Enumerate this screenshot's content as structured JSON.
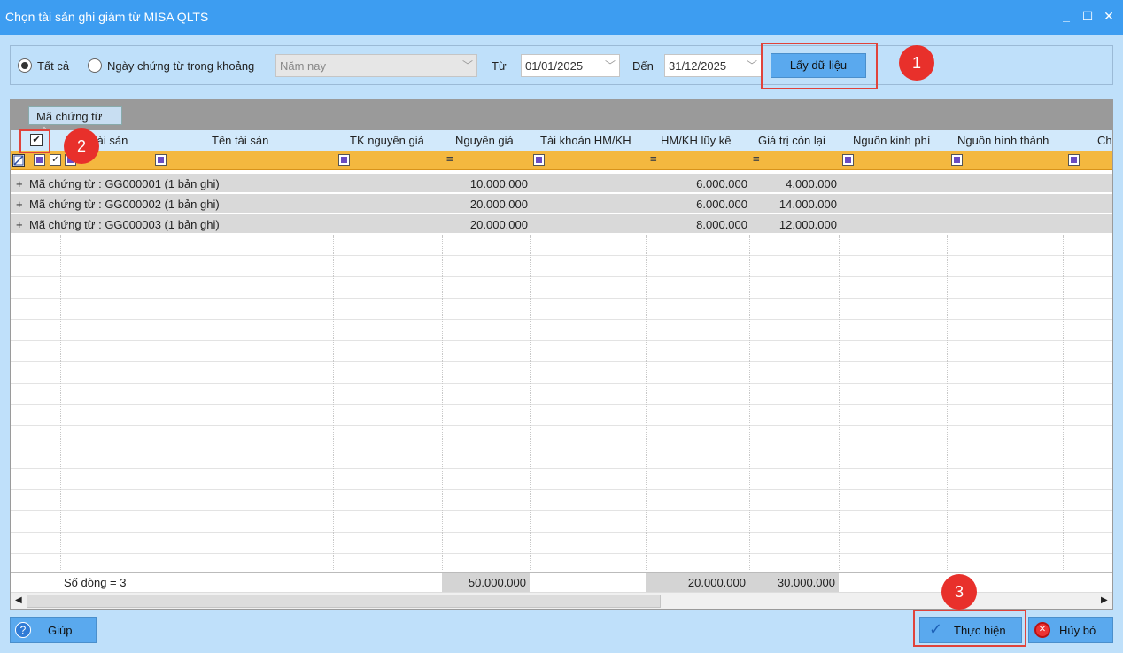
{
  "window": {
    "title": "Chọn tài sản ghi giảm từ MISA QLTS",
    "minimize": "_",
    "maximize": "☐",
    "close": "✕"
  },
  "filter": {
    "all_label": "Tất cả",
    "range_label": "Ngày chứng từ trong khoảng",
    "period_value": "Năm nay",
    "from_label": "Từ",
    "from_value": "01/01/2025",
    "to_label": "Đến",
    "to_value": "31/12/2025",
    "get_data_button": "Lấy dữ liệu"
  },
  "markers": {
    "m1": "1",
    "m2": "2",
    "m3": "3"
  },
  "grid": {
    "group_by": "Mã chứng từ",
    "sort_icon": "△",
    "columns": [
      "tài sản",
      "Tên tài sản",
      "TK nguyên giá",
      "Nguyên giá",
      "Tài khoản HM/KH",
      "HM/KH lũy kế",
      "Giá trị còn lại",
      "Nguồn kinh phí",
      "Nguồn hình thành",
      "Ch"
    ],
    "groups": [
      {
        "expand": "+",
        "label": "Mã chứng từ : GG000001 (1 bản ghi)",
        "original_value": "10.000.000",
        "depreciation": "6.000.000",
        "remaining": "4.000.000"
      },
      {
        "expand": "+",
        "label": "Mã chứng từ : GG000002 (1 bản ghi)",
        "original_value": "20.000.000",
        "depreciation": "6.000.000",
        "remaining": "14.000.000"
      },
      {
        "expand": "+",
        "label": "Mã chứng từ : GG000003 (1 bản ghi)",
        "original_value": "20.000.000",
        "depreciation": "8.000.000",
        "remaining": "12.000.000"
      }
    ],
    "footer": {
      "row_count": "Số dòng = 3",
      "original_total": "50.000.000",
      "depreciation_total": "20.000.000",
      "remaining_total": "30.000.000"
    }
  },
  "buttons": {
    "help": "Giúp",
    "execute": "Thực hiện",
    "cancel": "Hủy bỏ"
  },
  "colors": {
    "titlebar": "#3d9df1",
    "filter_row": "#f4b83f",
    "marker": "#e8302b",
    "button": "#5aa9ee"
  }
}
